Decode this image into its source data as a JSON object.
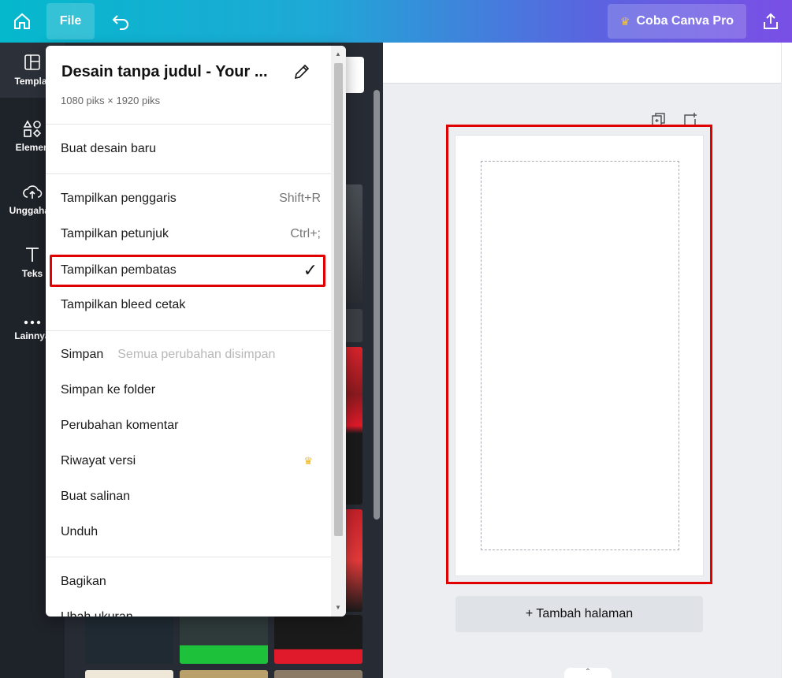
{
  "topbar": {
    "file_label": "File",
    "pro_label": "Coba Canva Pro"
  },
  "leftnav": {
    "items": [
      {
        "label": "Templat",
        "icon": "template-icon"
      },
      {
        "label": "Elemen",
        "icon": "elements-icon"
      },
      {
        "label": "Unggahan",
        "icon": "upload-icon"
      },
      {
        "label": "Teks",
        "icon": "text-icon"
      },
      {
        "label": "Lainnya",
        "icon": "more-icon"
      }
    ]
  },
  "menu": {
    "title": "Desain tanpa judul - Your ...",
    "dimensions": "1080 piks × 1920 piks",
    "new_design": "Buat desain baru",
    "show_rulers": "Tampilkan penggaris",
    "show_rulers_shortcut": "Shift+R",
    "show_guides": "Tampilkan petunjuk",
    "show_guides_shortcut": "Ctrl+;",
    "show_margins": "Tampilkan pembatas",
    "show_bleed": "Tampilkan bleed cetak",
    "save": "Simpan",
    "save_status": "Semua perubahan disimpan",
    "save_to_folder": "Simpan ke folder",
    "comment_changes": "Perubahan komentar",
    "version_history": "Riwayat versi",
    "make_copy": "Buat salinan",
    "download": "Unduh",
    "share": "Bagikan",
    "resize_partial": "Ubah ukuran"
  },
  "canvas": {
    "add_page": "+ Tambah halaman"
  },
  "colors": {
    "highlight": "#e00000",
    "crown": "#f0b81a",
    "nav_bg": "#1e2229"
  }
}
